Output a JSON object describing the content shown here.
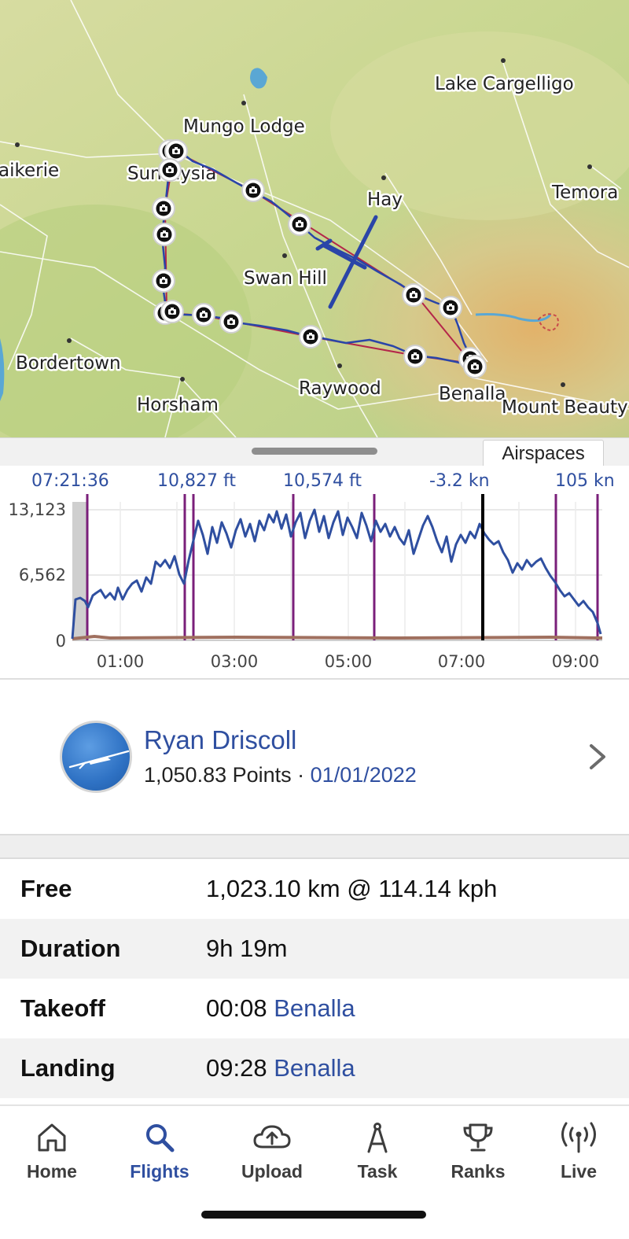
{
  "map": {
    "places": [
      "Lake Cargelligo",
      "Mungo Lodge",
      "aikerie",
      "Sunraysia",
      "Hay",
      "Temora",
      "Swan Hill",
      "Bordertown",
      "Raywood",
      "Horsham",
      "Benalla",
      "Mount Beauty"
    ],
    "photo_marker_icon": "camera-icon",
    "glider_icon": "glider-icon"
  },
  "drawer": {
    "airspaces_tab": "Airspaces"
  },
  "barograph": {
    "readouts": {
      "time": "07:21:36",
      "altitude": "10,827 ft",
      "altitude2": "10,574 ft",
      "vario": "-3.2 kn",
      "speed": "105 kn"
    },
    "y_tick_labels": [
      "13,123",
      "6,562",
      "0"
    ],
    "x_tick_labels": [
      "01:00",
      "03:00",
      "05:00",
      "07:00",
      "09:00"
    ],
    "colors": {
      "altitude_line": "#2f4fa0",
      "ground": "#a0705f",
      "task_marker": "#7a1f7a",
      "cursor": "#000000"
    }
  },
  "pilot": {
    "name": "Ryan Driscoll",
    "points": "1,050.83 Points",
    "separator": " · ",
    "date": "01/01/2022",
    "chevron_icon": "chevron-right-icon"
  },
  "stats": {
    "free": {
      "label": "Free",
      "value": "1,023.10 km @ 114.14 kph"
    },
    "duration": {
      "label": "Duration",
      "value": "9h 19m"
    },
    "takeoff": {
      "label": "Takeoff",
      "time": "00:08",
      "place": "Benalla"
    },
    "landing": {
      "label": "Landing",
      "time": "09:28",
      "place": "Benalla"
    }
  },
  "tabbar": {
    "tabs": [
      {
        "label": "Home",
        "icon": "home-icon"
      },
      {
        "label": "Flights",
        "icon": "search-icon",
        "active": true
      },
      {
        "label": "Upload",
        "icon": "cloud-upload-icon"
      },
      {
        "label": "Task",
        "icon": "compass-icon"
      },
      {
        "label": "Ranks",
        "icon": "trophy-icon"
      },
      {
        "label": "Live",
        "icon": "antenna-icon"
      }
    ]
  }
}
